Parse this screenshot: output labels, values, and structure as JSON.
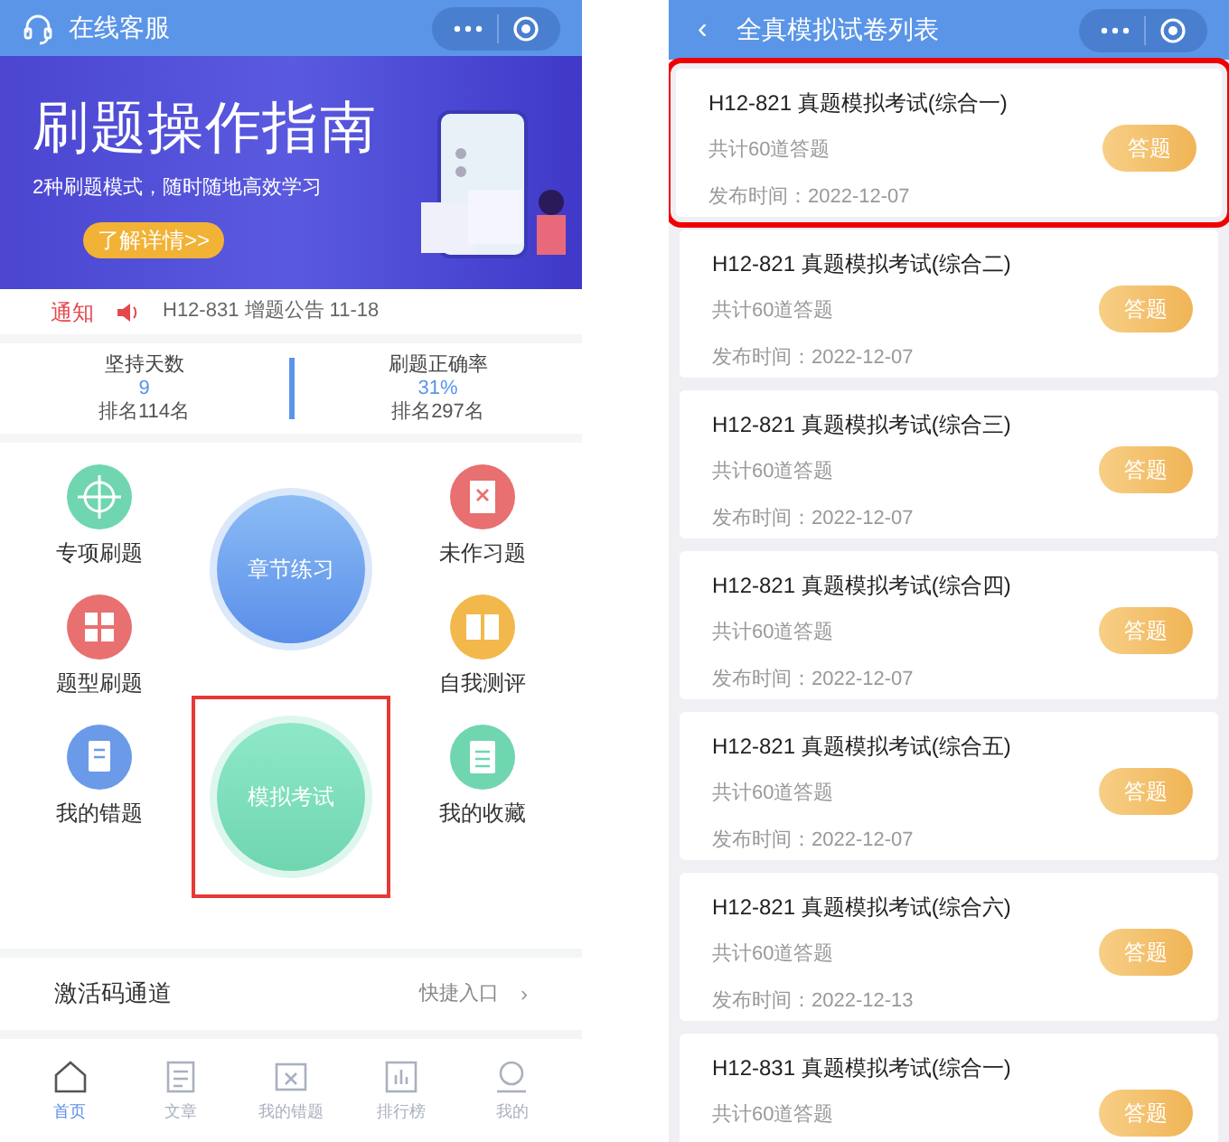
{
  "home": {
    "header": {
      "title": "在线客服"
    },
    "banner": {
      "title": "刷题操作指南",
      "subtitle": "2种刷题模式，随时随地高效学习",
      "button": "了解详情>>"
    },
    "notice": {
      "label": "通知",
      "text": "H12-831 增题公告 11-18"
    },
    "stats": [
      {
        "label": "坚持天数",
        "value": "9",
        "rank": "排名114名"
      },
      {
        "label": "刷题正确率",
        "value": "31%",
        "rank": "排名297名"
      }
    ],
    "features_left": [
      {
        "label": "专项刷题",
        "kind": "target",
        "color": "#6fd6b0"
      },
      {
        "label": "题型刷题",
        "kind": "grid",
        "color": "#e87070"
      },
      {
        "label": "我的错题",
        "kind": "doc",
        "color": "#6a9ae8"
      }
    ],
    "big_buttons": [
      {
        "label": "章节练习",
        "kind": "blue",
        "highlighted": false
      },
      {
        "label": "模拟考试",
        "kind": "green",
        "highlighted": true
      }
    ],
    "features_right": [
      {
        "label": "未作习题",
        "kind": "cross",
        "color": "#e87070"
      },
      {
        "label": "自我测评",
        "kind": "book",
        "color": "#f2b84b"
      },
      {
        "label": "我的收藏",
        "kind": "list",
        "color": "#6fd6b0"
      }
    ],
    "activation": {
      "title": "激活码通道",
      "link": "快捷入口",
      "chevron": "›"
    },
    "tabs": [
      {
        "label": "首页",
        "kind": "home",
        "selected": true
      },
      {
        "label": "文章",
        "kind": "article",
        "selected": false
      },
      {
        "label": "我的错题",
        "kind": "wrong",
        "selected": false
      },
      {
        "label": "排行榜",
        "kind": "rank",
        "selected": false
      },
      {
        "label": "我的",
        "kind": "me",
        "selected": false
      }
    ]
  },
  "exam_list": {
    "header": {
      "back": "‹",
      "title": "全真模拟试卷列表"
    },
    "exams": [
      {
        "title": "H12-821 真题模拟考试(综合一)",
        "count": "共计60道答题",
        "date": "发布时间：2022-12-07",
        "button": "答题",
        "highlighted": true
      },
      {
        "title": "H12-821 真题模拟考试(综合二)",
        "count": "共计60道答题",
        "date": "发布时间：2022-12-07",
        "button": "答题",
        "highlighted": false
      },
      {
        "title": "H12-821 真题模拟考试(综合三)",
        "count": "共计60道答题",
        "date": "发布时间：2022-12-07",
        "button": "答题",
        "highlighted": false
      },
      {
        "title": "H12-821 真题模拟考试(综合四)",
        "count": "共计60道答题",
        "date": "发布时间：2022-12-07",
        "button": "答题",
        "highlighted": false
      },
      {
        "title": "H12-821 真题模拟考试(综合五)",
        "count": "共计60道答题",
        "date": "发布时间：2022-12-07",
        "button": "答题",
        "highlighted": false
      },
      {
        "title": "H12-821 真题模拟考试(综合六)",
        "count": "共计60道答题",
        "date": "发布时间：2022-12-13",
        "button": "答题",
        "highlighted": false
      },
      {
        "title": "H12-831 真题模拟考试(综合一)",
        "count": "共计60道答题",
        "button": "答题",
        "highlighted": false
      }
    ]
  }
}
